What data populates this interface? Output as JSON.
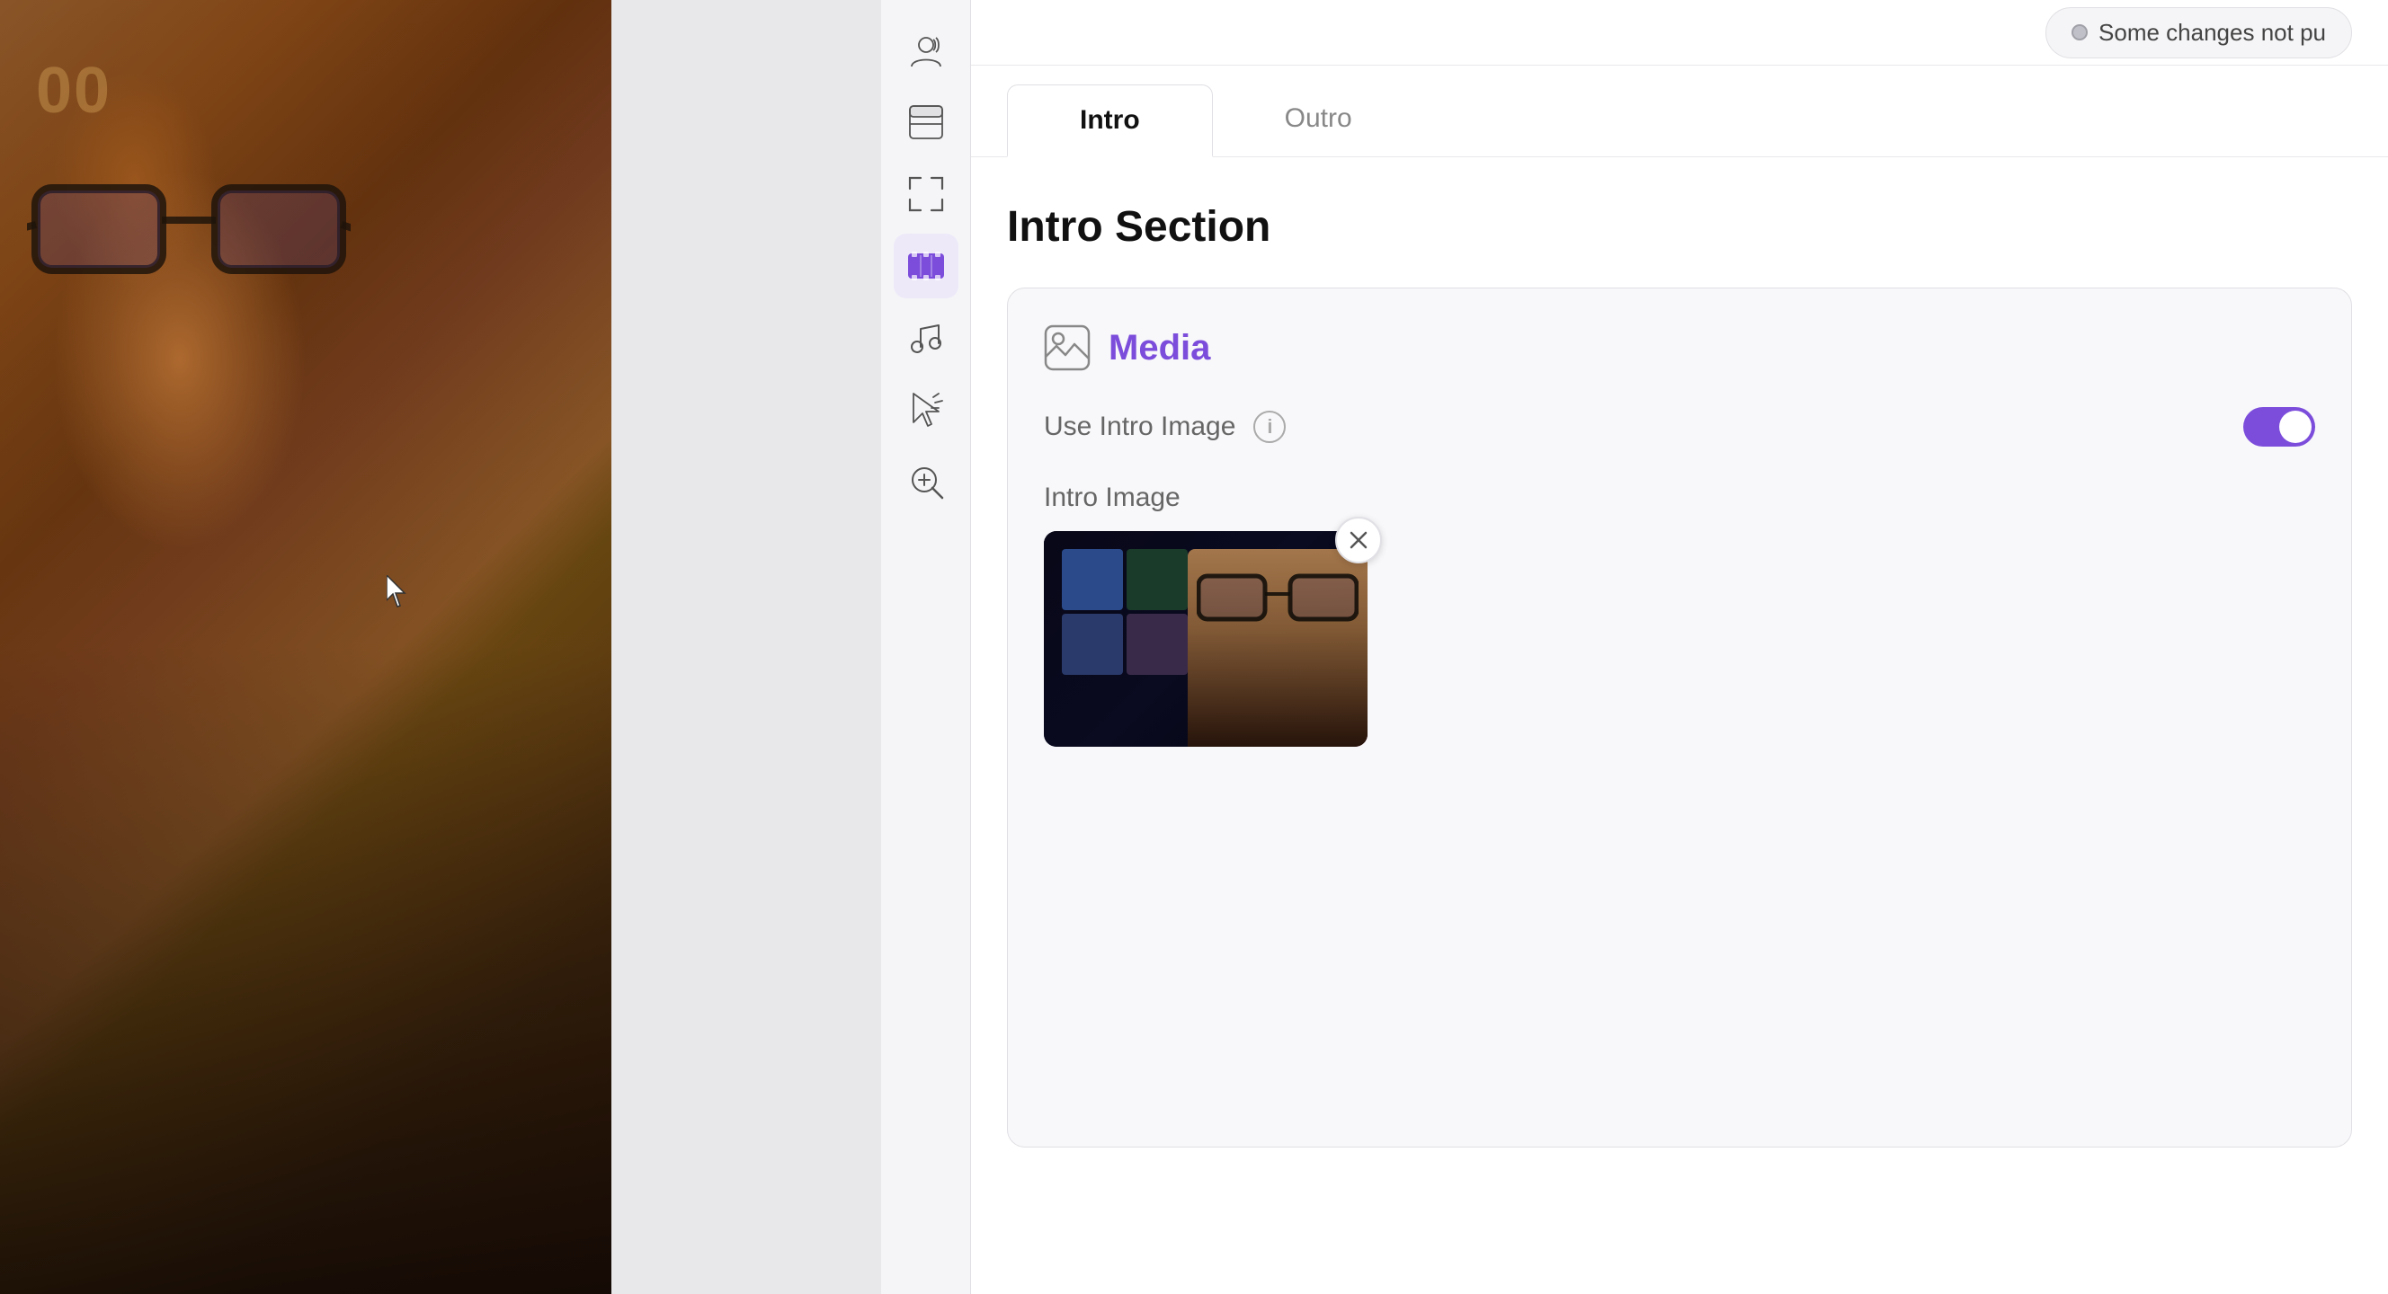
{
  "status": {
    "text": "Some changes not pu",
    "dot_color": "#c0c0c8"
  },
  "tabs": {
    "intro": {
      "label": "Intro",
      "active": true
    },
    "outro": {
      "label": "Outro",
      "active": false
    }
  },
  "intro_section": {
    "title": "Intro Section",
    "media_card": {
      "title": "Media",
      "use_intro_image_label": "Use Intro Image",
      "intro_image_label": "Intro Image"
    }
  },
  "sidebar": {
    "icons": [
      {
        "id": "user-icon",
        "label": "User / Avatar",
        "active": false
      },
      {
        "id": "layout-icon",
        "label": "Layout",
        "active": false
      },
      {
        "id": "frame-icon",
        "label": "Frame",
        "active": false
      },
      {
        "id": "scenes-icon",
        "label": "Scenes",
        "active": true
      },
      {
        "id": "music-icon",
        "label": "Music",
        "active": false
      },
      {
        "id": "cursor-icon",
        "label": "Cursor",
        "active": false
      },
      {
        "id": "zoom-icon",
        "label": "Zoom",
        "active": false
      }
    ]
  },
  "close_button": {
    "label": "✕"
  }
}
